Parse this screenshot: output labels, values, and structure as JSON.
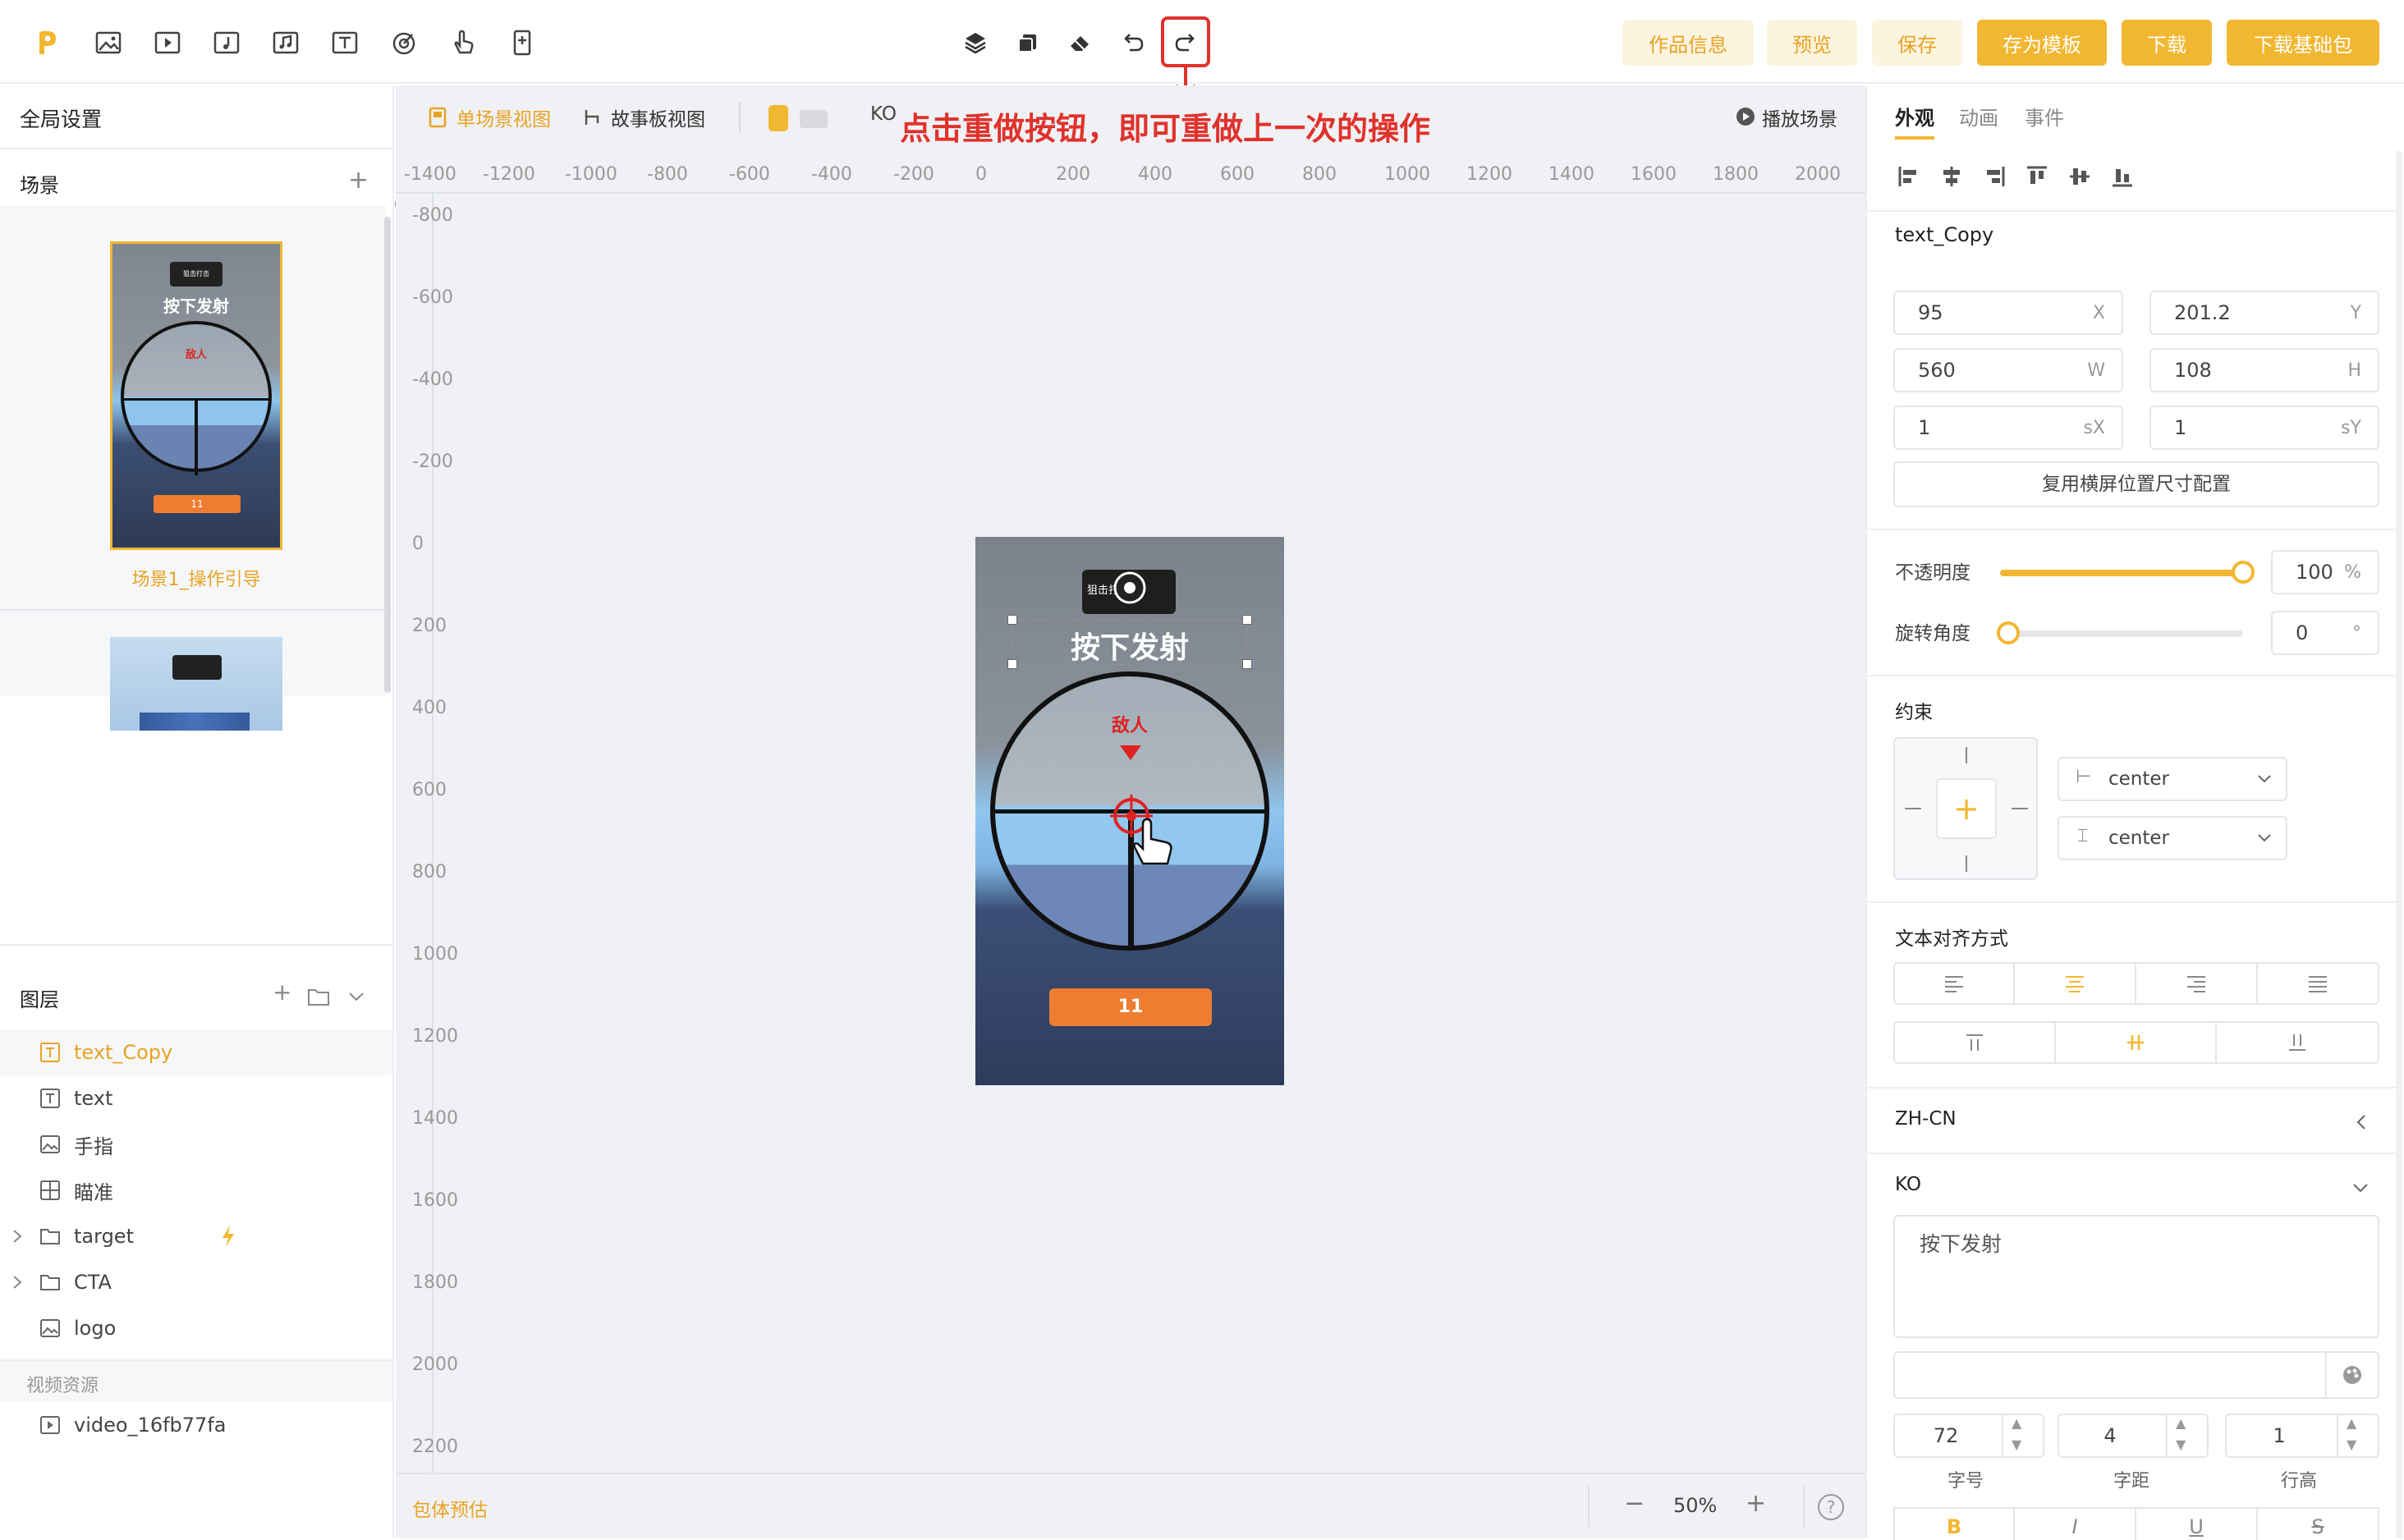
{
  "topbar": {
    "tools": [
      "logo-icon",
      "image-icon",
      "video-icon",
      "audio-icon",
      "music-icon",
      "text-icon",
      "target-icon",
      "hand-icon",
      "phone-icon"
    ],
    "center_tools": [
      "layers-icon",
      "copy-icon",
      "eraser-icon",
      "undo-icon",
      "redo-icon"
    ],
    "buttons": {
      "info": "作品信息",
      "preview": "预览",
      "save": "保存",
      "save_template": "存为模板",
      "download": "下载",
      "download_base": "下载基础包"
    }
  },
  "annotation": "点击重做按钮，即可重做上一次的操作",
  "left": {
    "global_settings": "全局设置",
    "scenes_title": "场景",
    "scene1_label": "场景1_操作引导",
    "scene1_badge": "狙击打击",
    "scene1_caption": "按下发射",
    "scene1_enemy": "敌人",
    "scene1_cta": "11",
    "layers_title": "图层",
    "layers": [
      {
        "name": "text_Copy",
        "icon": "text-icon"
      },
      {
        "name": "text",
        "icon": "text-icon"
      },
      {
        "name": "手指",
        "icon": "image-icon"
      },
      {
        "name": "瞄准",
        "icon": "sprite-icon"
      },
      {
        "name": "target",
        "icon": "folder-icon"
      },
      {
        "name": "CTA",
        "icon": "folder-icon"
      },
      {
        "name": "logo",
        "icon": "image-icon"
      }
    ],
    "video_title": "视频资源",
    "video_item": "video_16fb77fa"
  },
  "canvas": {
    "view_single": "单场景视图",
    "view_story": "故事板视图",
    "lang": "KO",
    "play_scene": "播放场景",
    "ruler_h": [
      "-1400",
      "-1200",
      "-1000",
      "-800",
      "-600",
      "-400",
      "-200",
      "0",
      "200",
      "400",
      "600",
      "800",
      "1000",
      "1200",
      "1400",
      "1600",
      "1800",
      "2000"
    ],
    "ruler_v": [
      "-800",
      "-600",
      "-400",
      "-200",
      "0",
      "200",
      "400",
      "600",
      "800",
      "1000",
      "1200",
      "1400",
      "1600",
      "1800",
      "2000",
      "2200"
    ],
    "origin": "0",
    "preview_badge": "狙击打击",
    "preview_caption": "按下发射",
    "preview_enemy": "敌人",
    "preview_cta": "11",
    "package_estimate": "包体预估",
    "zoom": "50%",
    "zoom_minus": "−",
    "zoom_plus": "+",
    "help": "?"
  },
  "right": {
    "tabs": [
      "外观",
      "动画",
      "事件"
    ],
    "element_name": "text_Copy",
    "x": "95",
    "y": "201.2",
    "w": "560",
    "h": "108",
    "sx": "1",
    "sy": "1",
    "lbl_x": "X",
    "lbl_y": "Y",
    "lbl_w": "W",
    "lbl_h": "H",
    "lbl_sx": "sX",
    "lbl_sy": "sY",
    "reuse_btn": "复用横屏位置尺寸配置",
    "opacity_label": "不透明度",
    "opacity": 100,
    "opacity_value": "100",
    "percent": "%",
    "rotation_label": "旋转角度",
    "rotation": 0,
    "rotation_value": "0",
    "degree": "°",
    "constraint_title": "约束",
    "constraint_h": "center",
    "constraint_v": "center",
    "text_align_title": "文本对齐方式",
    "zh_cn": "ZH-CN",
    "ko": "KO",
    "text_value": "按下发射",
    "font_size": "72",
    "letter_spacing": "4",
    "line_height": "1",
    "font_size_label": "字号",
    "letter_spacing_label": "字距",
    "line_height_label": "行高",
    "style_buttons": [
      "B",
      "I",
      "U",
      "S"
    ]
  },
  "colors": {
    "accent": "#f2b731",
    "annotation": "#e0322c",
    "selected_text": "#e8a323"
  }
}
